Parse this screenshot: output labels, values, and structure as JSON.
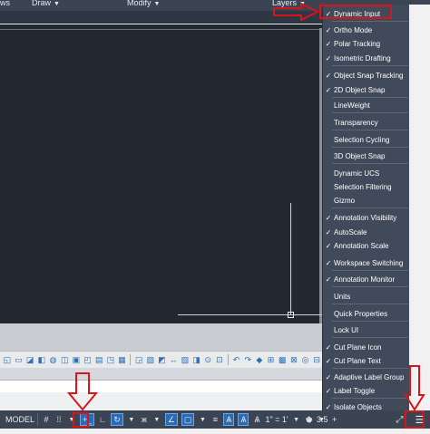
{
  "ribbon": {
    "panels": [
      "ws",
      "Draw",
      "Modify",
      "Layers"
    ]
  },
  "status_bar": {
    "model_label": "MODEL",
    "scale_label": "1\" = 1'",
    "annotation_count": "3.5"
  },
  "customization_menu": {
    "items": [
      {
        "label": "Dynamic Input",
        "checked": true
      },
      {
        "label": "Ortho Mode",
        "checked": true
      },
      {
        "label": "Polar Tracking",
        "checked": true
      },
      {
        "label": "Isometric Drafting",
        "checked": true
      },
      {
        "label": "Object Snap Tracking",
        "checked": true
      },
      {
        "label": "2D Object Snap",
        "checked": true
      },
      {
        "label": "LineWeight",
        "checked": false
      },
      {
        "label": "Transparency",
        "checked": false
      },
      {
        "label": "Selection Cycling",
        "checked": false
      },
      {
        "label": "3D Object Snap",
        "checked": false
      },
      {
        "label": "Dynamic UCS",
        "checked": false
      },
      {
        "label": "Selection Filtering",
        "checked": false
      },
      {
        "label": "Gizmo",
        "checked": false
      },
      {
        "label": "Annotation Visibility",
        "checked": true
      },
      {
        "label": "AutoScale",
        "checked": true
      },
      {
        "label": "Annotation Scale",
        "checked": true
      },
      {
        "label": "Workspace Switching",
        "checked": true
      },
      {
        "label": "Annotation Monitor",
        "checked": true
      },
      {
        "label": "Units",
        "checked": false
      },
      {
        "label": "Quick Properties",
        "checked": false
      },
      {
        "label": "Lock UI",
        "checked": false
      },
      {
        "label": "Cut Plane Icon",
        "checked": true
      },
      {
        "label": "Cut Plane Text",
        "checked": true
      },
      {
        "label": "Adaptive Label Group",
        "checked": true
      },
      {
        "label": "Label Toggle",
        "checked": true
      },
      {
        "label": "Isolate Objects",
        "checked": true
      }
    ]
  },
  "colors": {
    "accent_red": "#d9141b",
    "menu_bg": "#414a5a",
    "canvas_bg": "#212830"
  }
}
